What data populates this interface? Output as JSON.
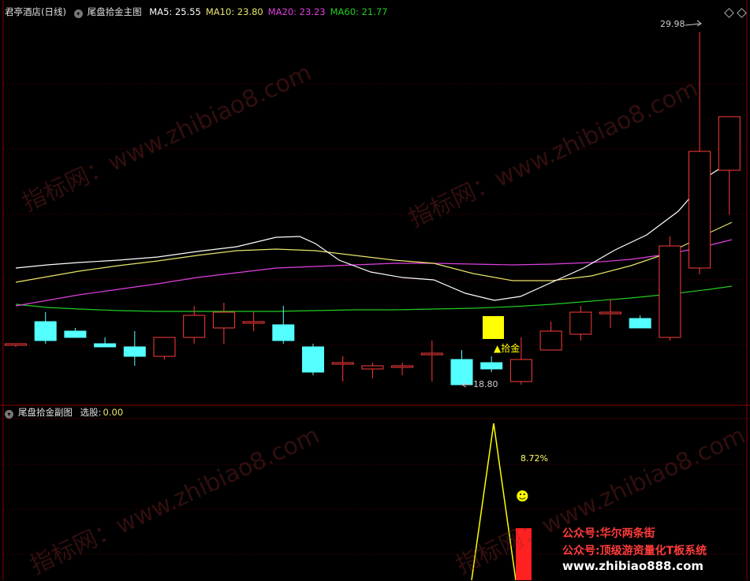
{
  "main_panel": {
    "stock": "君亭酒店(日线)",
    "indicator": "尾盘拾金主图",
    "ma": [
      {
        "label": "MA5:",
        "value": "25.55",
        "color": "#ffffff"
      },
      {
        "label": "MA10:",
        "value": "23.80",
        "color": "#e8e56a"
      },
      {
        "label": "MA20:",
        "value": "23.23",
        "color": "#e040e0"
      },
      {
        "label": "MA60:",
        "value": "21.77",
        "color": "#22cc22"
      }
    ],
    "high_label": "29.98",
    "low_label": "18.80",
    "signal_label": "▲拾金"
  },
  "sub_panel": {
    "indicator": "尾盘拾金副图",
    "select_label": "选股:",
    "select_value": "0.00",
    "pct_label": "8.72%",
    "smiley": "☻"
  },
  "watermarks": [
    "指标网：www.zhibiao8.com"
  ],
  "promo": {
    "line1": "公众号:华尔两条街",
    "line2": "公众号:顶级游资量化T板系统",
    "line3": "www.zhibiao888.com"
  },
  "colors": {
    "up": "#ff3b3b",
    "down": "#54ffff",
    "signal": "#ffff00",
    "grid": "#6a0000"
  },
  "chart_data": {
    "type": "candlestick",
    "ylim": [
      18.5,
      30.5
    ],
    "candles": [
      {
        "o": 20.1,
        "h": 20.0,
        "l": 20.0,
        "c": 20.1
      },
      {
        "o": 20.8,
        "h": 21.1,
        "l": 20.1,
        "c": 20.2
      },
      {
        "o": 20.5,
        "h": 20.6,
        "l": 20.3,
        "c": 20.3
      },
      {
        "o": 20.1,
        "h": 20.3,
        "l": 20.0,
        "c": 20.0
      },
      {
        "o": 20.0,
        "h": 20.5,
        "l": 19.4,
        "c": 19.7
      },
      {
        "o": 19.7,
        "h": 20.3,
        "l": 19.6,
        "c": 20.3
      },
      {
        "o": 20.3,
        "h": 21.3,
        "l": 20.1,
        "c": 21.0
      },
      {
        "o": 20.6,
        "h": 21.4,
        "l": 20.1,
        "c": 21.1
      },
      {
        "o": 20.8,
        "h": 21.1,
        "l": 20.5,
        "c": 20.8
      },
      {
        "o": 20.7,
        "h": 21.3,
        "l": 20.1,
        "c": 20.2
      },
      {
        "o": 20.0,
        "h": 20.1,
        "l": 19.1,
        "c": 19.2
      },
      {
        "o": 19.5,
        "h": 19.7,
        "l": 18.9,
        "c": 19.5
      },
      {
        "o": 19.3,
        "h": 19.5,
        "l": 19.0,
        "c": 19.4
      },
      {
        "o": 19.4,
        "h": 19.5,
        "l": 19.1,
        "c": 19.4
      },
      {
        "o": 19.8,
        "h": 20.2,
        "l": 18.9,
        "c": 19.8
      },
      {
        "o": 19.6,
        "h": 19.9,
        "l": 18.8,
        "c": 18.8
      },
      {
        "o": 19.5,
        "h": 19.7,
        "l": 19.2,
        "c": 19.3
      },
      {
        "o": 18.9,
        "h": 20.3,
        "l": 18.8,
        "c": 19.6
      },
      {
        "o": 19.9,
        "h": 20.8,
        "l": 19.9,
        "c": 20.5
      },
      {
        "o": 20.4,
        "h": 21.3,
        "l": 20.2,
        "c": 21.1
      },
      {
        "o": 21.1,
        "h": 21.5,
        "l": 20.6,
        "c": 21.1
      },
      {
        "o": 20.9,
        "h": 21.0,
        "l": 20.6,
        "c": 20.6
      },
      {
        "o": 20.3,
        "h": 23.5,
        "l": 20.2,
        "c": 23.2
      },
      {
        "o": 22.5,
        "h": 29.98,
        "l": 22.3,
        "c": 26.2
      },
      {
        "o": 25.6,
        "h": 27.3,
        "l": 24.2,
        "c": 27.3
      }
    ]
  }
}
